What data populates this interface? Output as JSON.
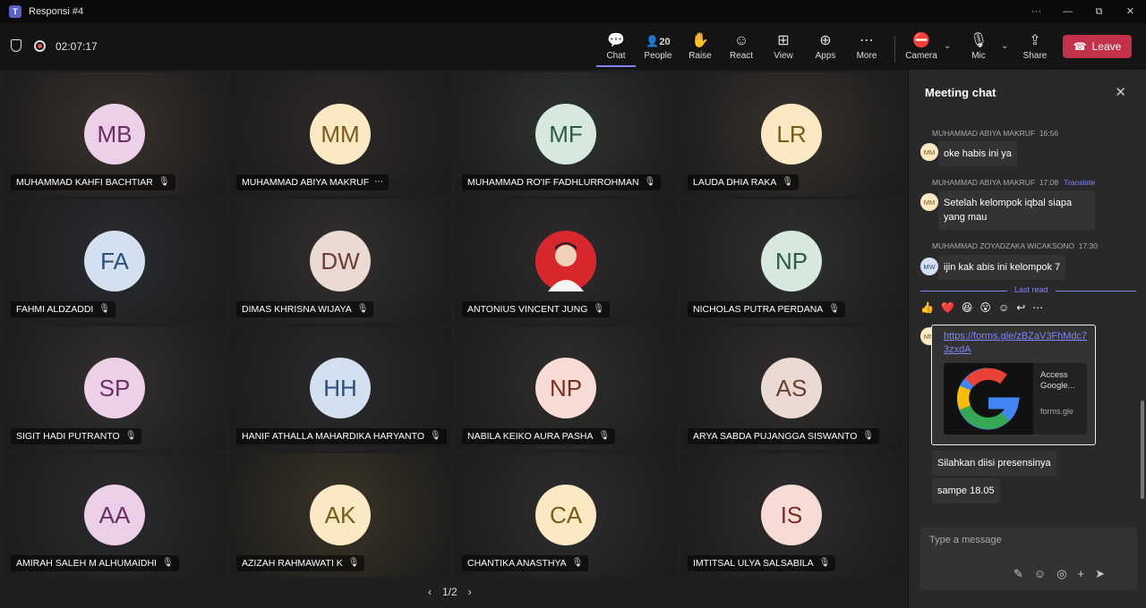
{
  "window": {
    "title": "Responsi #4",
    "controls": [
      "···",
      "—",
      "⧉",
      "✕"
    ]
  },
  "toolbar": {
    "timer": "02:07:17",
    "people_count": "20",
    "buttons": [
      {
        "label": "Chat",
        "icon": "chat-icon"
      },
      {
        "label": "People",
        "icon": "people-icon"
      },
      {
        "label": "Raise",
        "icon": "hand-icon"
      },
      {
        "label": "React",
        "icon": "smile-icon"
      },
      {
        "label": "View",
        "icon": "grid-icon"
      },
      {
        "label": "Apps",
        "icon": "plus-icon"
      },
      {
        "label": "More",
        "icon": "more-icon"
      },
      {
        "label": "Camera",
        "icon": "camera-off-icon"
      },
      {
        "label": "Mic",
        "icon": "mic-off-icon"
      },
      {
        "label": "Share",
        "icon": "share-icon"
      }
    ],
    "leave_label": "Leave"
  },
  "participants": [
    {
      "initials": "MB",
      "name": "MUHAMMAD KAHFI BACHTIAR",
      "bg": "#ecd0e7",
      "fg": "#6b2f63"
    },
    {
      "initials": "MM",
      "name": "MUHAMMAD ABIYA MAKRUF",
      "bg": "#fbe9c4",
      "fg": "#7a5a17"
    },
    {
      "initials": "MF",
      "name": "MUHAMMAD RO'IF FADHLURROHMAN",
      "bg": "#d7e8df",
      "fg": "#2d5b45"
    },
    {
      "initials": "LR",
      "name": "LAUDA DHIA RAKA",
      "bg": "#fbe9c4",
      "fg": "#7a5a17"
    },
    {
      "initials": "FA",
      "name": "FAHMI ALDZADDI",
      "bg": "#d3e0f0",
      "fg": "#2d4d7a"
    },
    {
      "initials": "DW",
      "name": "DIMAS KHRISNA WIJAYA",
      "bg": "#ebd9d3",
      "fg": "#6b3f30"
    },
    {
      "initials": "",
      "name": "ANTONIUS VINCENT JUNG",
      "bg": "#d9272e",
      "fg": "#fff"
    },
    {
      "initials": "NP",
      "name": "NICHOLAS PUTRA PERDANA",
      "bg": "#d7e8df",
      "fg": "#2d5b45"
    },
    {
      "initials": "SP",
      "name": "SIGIT HADI PUTRANTO",
      "bg": "#ecd0e7",
      "fg": "#6b2f63"
    },
    {
      "initials": "HH",
      "name": "HANIF ATHALLA MAHARDIKA HARYANTO",
      "bg": "#d3e0f0",
      "fg": "#2d4d7a"
    },
    {
      "initials": "NP",
      "name": "NABILA KEIKO AURA PASHA",
      "bg": "#f7dbd5",
      "fg": "#7a2f22"
    },
    {
      "initials": "AS",
      "name": "ARYA SABDA PUJANGGA SISWANTO",
      "bg": "#ebd9d3",
      "fg": "#6b3f30"
    },
    {
      "initials": "AA",
      "name": "AMIRAH SALEH M ALHUMAIDHI",
      "bg": "#ecd0e7",
      "fg": "#6b2f63"
    },
    {
      "initials": "AK",
      "name": "AZIZAH RAHMAWATI K",
      "bg": "#fbe9c4",
      "fg": "#7a5a17"
    },
    {
      "initials": "CA",
      "name": "CHANTIKA ANASTHYA",
      "bg": "#fbe9c4",
      "fg": "#7a5a17"
    },
    {
      "initials": "IS",
      "name": "IMTITSAL ULYA SALSABILA",
      "bg": "#f7dbd5",
      "fg": "#7a2f22"
    }
  ],
  "pager": {
    "text": "1/2"
  },
  "chat": {
    "title": "Meeting chat",
    "messages": [
      {
        "sender": "MUHAMMAD ABIYA MAKRUF",
        "time": "16:56",
        "text": "oke habis ini ya",
        "initials": "MM"
      },
      {
        "sender": "MUHAMMAD ABIYA MAKRUF",
        "time": "17:08",
        "translate": "Translate",
        "text": "Setelah kelompok iqbal siapa yang mau",
        "initials": "MM"
      },
      {
        "sender": "MUHAMMAD ZOYADZAKA WICAKSONO",
        "time": "17:30",
        "text": "ijin kak abis ini kelompok 7",
        "initials": "MW"
      }
    ],
    "last_read": "Last read",
    "reactions": [
      "👍",
      "❤️",
      "😆",
      "😮",
      "☺",
      "↩",
      "⋯"
    ],
    "link_message": {
      "initials": "MM",
      "url": "https://forms.gle/zBZaV3FhMdc73zxdA",
      "preview_title": "Access Google...",
      "preview_domain": "forms.gle"
    },
    "followups": [
      "Silahkan diisi presensinya",
      "sampe 18.05"
    ],
    "composer_placeholder": "Type a message"
  }
}
